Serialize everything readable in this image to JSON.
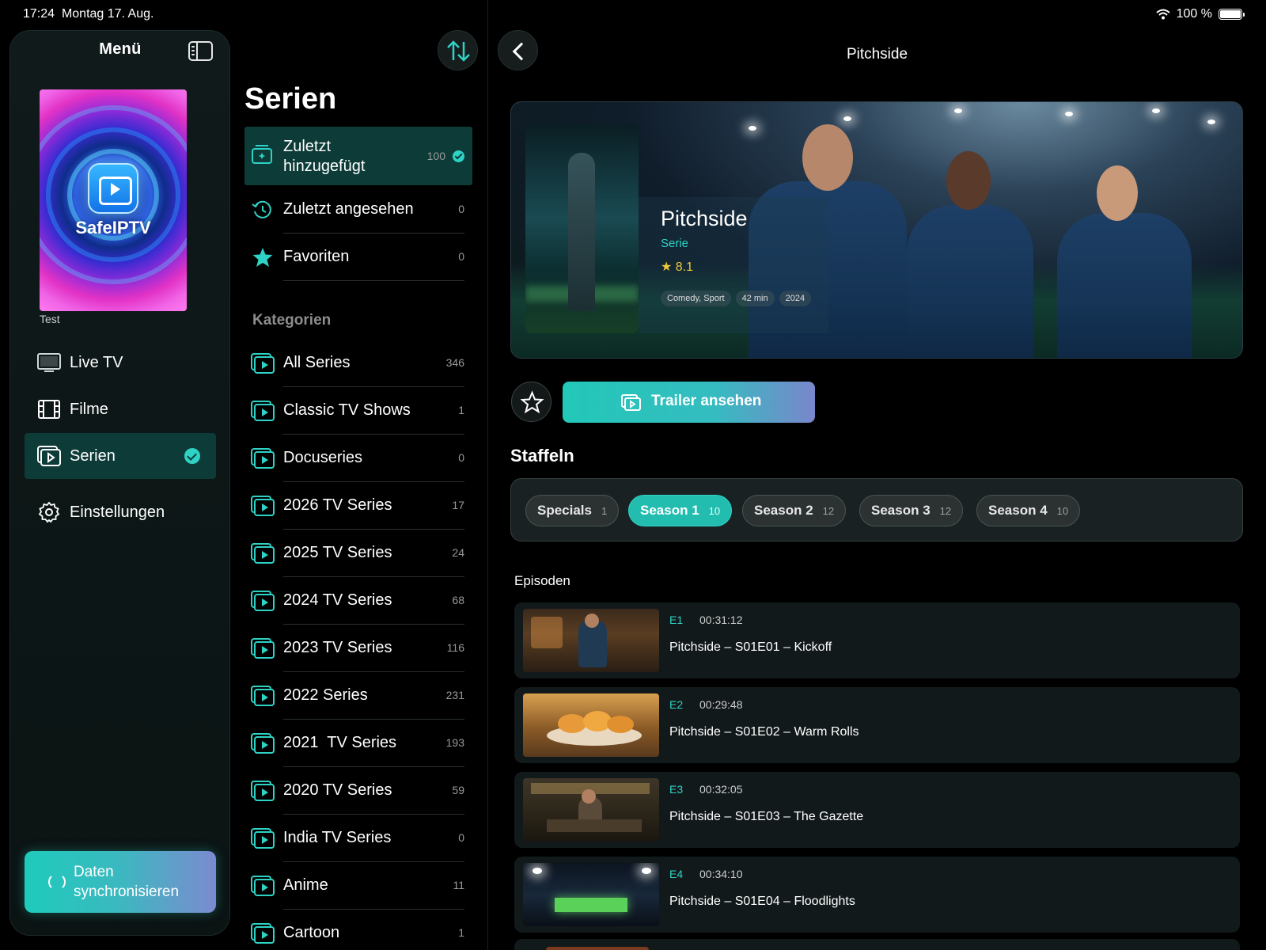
{
  "status": {
    "time": "17:24",
    "date": "Montag 17. Aug.",
    "battery": "100 %"
  },
  "sidebar": {
    "title": "Menü",
    "profile_art_text": "SafeIPTV",
    "profile_label": "Test",
    "items": [
      {
        "label": "Live TV",
        "icon": "tv-icon"
      },
      {
        "label": "Filme",
        "icon": "film-icon"
      },
      {
        "label": "Serien",
        "icon": "series-icon",
        "active": true
      },
      {
        "label": "Einstellungen",
        "icon": "gear-icon"
      }
    ],
    "sync_label": "Daten synchronisieren"
  },
  "middle": {
    "title": "Serien",
    "quick": [
      {
        "label": "Zuletzt hinzugefügt",
        "count": "100",
        "active": true,
        "icon": "added-icon"
      },
      {
        "label": "Zuletzt angesehen",
        "count": "0",
        "icon": "history-icon"
      },
      {
        "label": "Favoriten",
        "count": "0",
        "icon": "star-icon"
      }
    ],
    "categories_title": "Kategorien",
    "categories": [
      {
        "label": "All Series",
        "count": "346"
      },
      {
        "label": "Classic TV Shows",
        "count": "1"
      },
      {
        "label": "Docuseries",
        "count": "0"
      },
      {
        "label": "2026 TV Series",
        "count": "17"
      },
      {
        "label": "2025 TV Series",
        "count": "24"
      },
      {
        "label": "2024 TV Series",
        "count": "68"
      },
      {
        "label": "2023 TV Series",
        "count": "116"
      },
      {
        "label": "2022 Series",
        "count": "231"
      },
      {
        "label": "2021  TV Series",
        "count": "193"
      },
      {
        "label": "2020 TV Series",
        "count": "59"
      },
      {
        "label": "India TV Series",
        "count": "0"
      },
      {
        "label": "Anime",
        "count": "11"
      },
      {
        "label": "Cartoon",
        "count": "1"
      }
    ]
  },
  "detail": {
    "title": "Pitchside",
    "hero": {
      "name": "Pitchside",
      "type": "Serie",
      "rating": "8.1",
      "tags": [
        "Comedy, Sport",
        "42 min",
        "2024"
      ]
    },
    "trailer_label": "Trailer ansehen",
    "seasons_title": "Staffeln",
    "seasons": [
      {
        "label": "Specials",
        "count": "1"
      },
      {
        "label": "Season 1",
        "count": "10",
        "active": true
      },
      {
        "label": "Season 2",
        "count": "12"
      },
      {
        "label": "Season 3",
        "count": "12"
      },
      {
        "label": "Season 4",
        "count": "10"
      }
    ],
    "episodes_title": "Episoden",
    "episodes": [
      {
        "num": "E1",
        "duration": "00:31:12",
        "title": "Pitchside – S01E01 – Kickoff"
      },
      {
        "num": "E2",
        "duration": "00:29:48",
        "title": "Pitchside – S01E02 – Warm Rolls"
      },
      {
        "num": "E3",
        "duration": "00:32:05",
        "title": "Pitchside – S01E03 – The Gazette"
      },
      {
        "num": "E4",
        "duration": "00:34:10",
        "title": "Pitchside – S01E04 – Floodlights"
      }
    ]
  },
  "colors": {
    "accent": "#2ed3c6",
    "active_bg": "#0d3b38",
    "rating": "#f0c93a"
  }
}
